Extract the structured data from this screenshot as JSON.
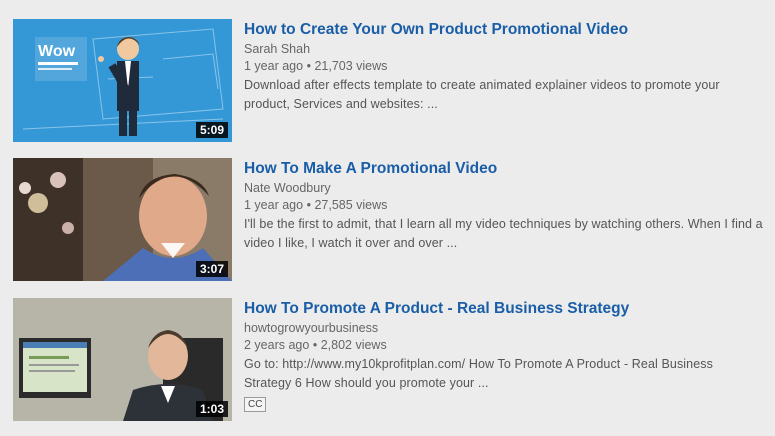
{
  "results": [
    {
      "title": "How to Create Your Own Product Promotional Video",
      "channel": "Sarah Shah",
      "age": "1 year ago",
      "separator": "•",
      "views": "21,703 views",
      "description": "Download after effects template to create animated explainer videos to promote your product, Services and websites: ...",
      "duration": "5:09",
      "thumb_text": "Wow"
    },
    {
      "title": "How To Make A Promotional Video",
      "channel": "Nate Woodbury",
      "age": "1 year ago",
      "separator": "•",
      "views": "27,585 views",
      "description": "I'll be the first to admit, that I learn all my video techniques by watching others. When I find a video I like, I watch it over and over ...",
      "duration": "3:07"
    },
    {
      "title": "How To Promote A Product - Real Business Strategy",
      "channel": "howtogrowyourbusiness",
      "age": "2 years ago",
      "separator": "•",
      "views": "2,802 views",
      "description": "Go to: http://www.my10kprofitplan.com/ How To Promote A Product - Real Business Strategy 6 How should you promote your ...",
      "duration": "1:03",
      "badge": "CC"
    }
  ]
}
